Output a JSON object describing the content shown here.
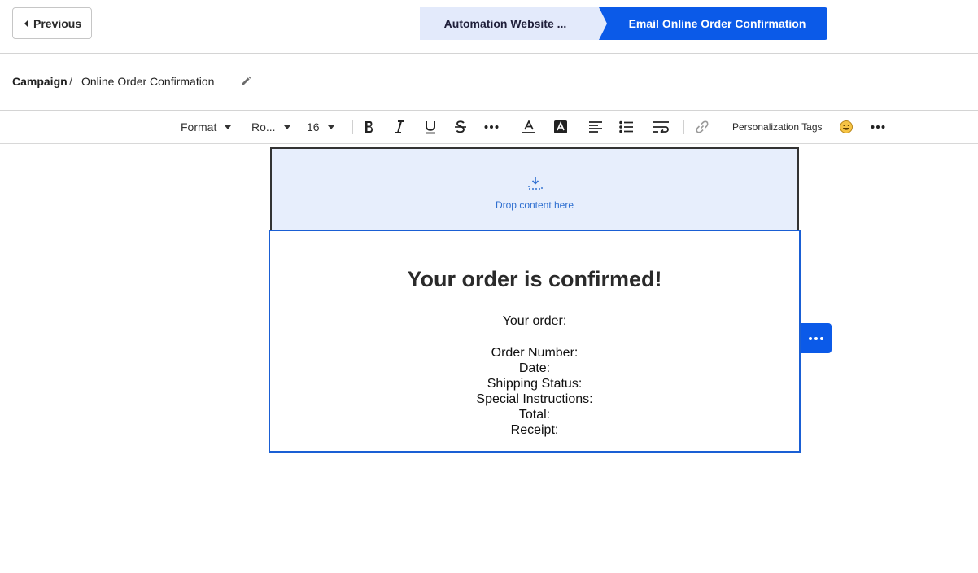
{
  "header": {
    "previous_label": "Previous",
    "steps": [
      {
        "label": "Automation Website ..."
      },
      {
        "label": "Email Online Order Confirmation"
      }
    ],
    "accent_color": "#0b5ae8"
  },
  "breadcrumb": {
    "root": "Campaign",
    "separator": "/",
    "current": "Online Order Confirmation"
  },
  "toolbar": {
    "format_label": "Format",
    "font_label": "Ro...",
    "size_label": "16",
    "personalization_label": "Personalization Tags",
    "icons": [
      "bold-icon",
      "italic-icon",
      "underline-icon",
      "strikethrough-icon",
      "more-icon",
      "text-color-icon",
      "highlight-icon",
      "align-left-icon",
      "bullet-list-icon",
      "line-height-icon",
      "link-icon",
      "emoji-icon",
      "overflow-icon"
    ]
  },
  "canvas": {
    "drop_text": "Drop content here",
    "heading": "Your order is confirmed!",
    "order_label": "Your order:",
    "fields": [
      "Order Number:",
      "Date:",
      "Shipping Status:",
      "Special Instructions:",
      "Total:",
      "Receipt:"
    ]
  }
}
